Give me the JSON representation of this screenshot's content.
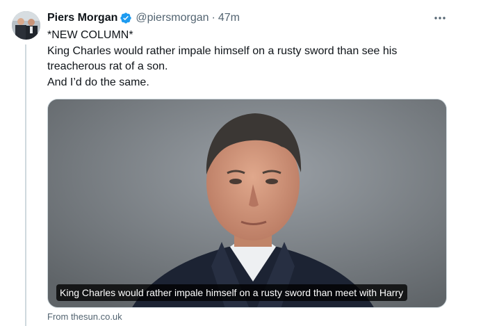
{
  "tweet": {
    "author_name": "Piers Morgan",
    "handle": "@piersmorgan",
    "separator": "·",
    "timestamp": "47m",
    "verified_icon": "verified-badge-icon",
    "more_icon": "more-options-icon",
    "text_lines": [
      "*NEW COLUMN*",
      "King Charles would rather impale himself on a rusty sword than see his",
      "treacherous rat of a son.",
      "And I’d do the same."
    ]
  },
  "card": {
    "caption": "King Charles would rather impale himself on a rusty sword than meet with Harry",
    "source": "From thesun.co.uk"
  },
  "colors": {
    "verified": "#1d9bf0",
    "secondary_text": "#536471",
    "thread_line": "#cfd9de"
  }
}
